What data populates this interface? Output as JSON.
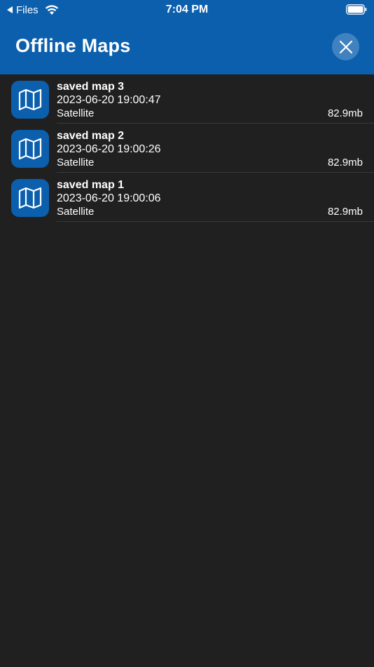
{
  "status_bar": {
    "back_label": "Files",
    "time": "7:04 PM"
  },
  "header": {
    "title": "Offline Maps"
  },
  "maps": [
    {
      "name": "saved map 3",
      "date": "2023-06-20 19:00:47",
      "type": "Satellite",
      "size": "82.9mb"
    },
    {
      "name": "saved map 2",
      "date": "2023-06-20 19:00:26",
      "type": "Satellite",
      "size": "82.9mb"
    },
    {
      "name": "saved map 1",
      "date": "2023-06-20 19:00:06",
      "type": "Satellite",
      "size": "82.9mb"
    }
  ],
  "colors": {
    "accent": "#0b5fad",
    "background": "#202020"
  },
  "icons": {
    "map_thumbnail": "map-icon",
    "close": "close-icon"
  }
}
